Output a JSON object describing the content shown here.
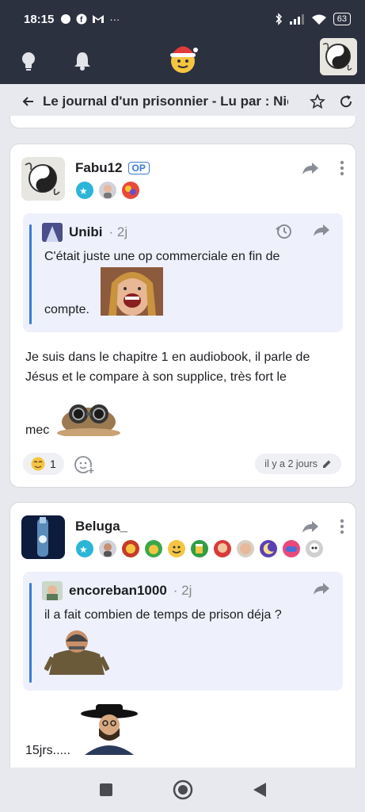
{
  "status": {
    "time": "18:15",
    "battery": "63"
  },
  "appbar": {
    "icons": [
      "lightbulb-icon",
      "bell-icon",
      "logo-santa-icon",
      "profile-avatar"
    ]
  },
  "topic": {
    "title": "Le journal d'un prisonnier - Lu par : Nic"
  },
  "posts": [
    {
      "author": "Fabu12",
      "op_badge": "OP",
      "quote": {
        "author": "Unibi",
        "time": "· 2j",
        "text1": "C'était juste une op commerciale en fin de",
        "text2": "compte."
      },
      "body1": "Je suis dans le chapitre 1 en audiobook, il parle de Jésus et le compare à son supplice, très fort le",
      "body2": "mec",
      "reaction_count": "1",
      "date": "il y a 2 jours"
    },
    {
      "author": "Beluga_",
      "quote": {
        "author": "encoreban1000",
        "time": "· 2j",
        "text1": "il a fait combien de temps de prison déja ?"
      },
      "body1": "15jrs....."
    }
  ],
  "colors": {
    "accent": "#3a7bd5",
    "header": "#2c3140",
    "quote_bg": "#eef0fb"
  }
}
